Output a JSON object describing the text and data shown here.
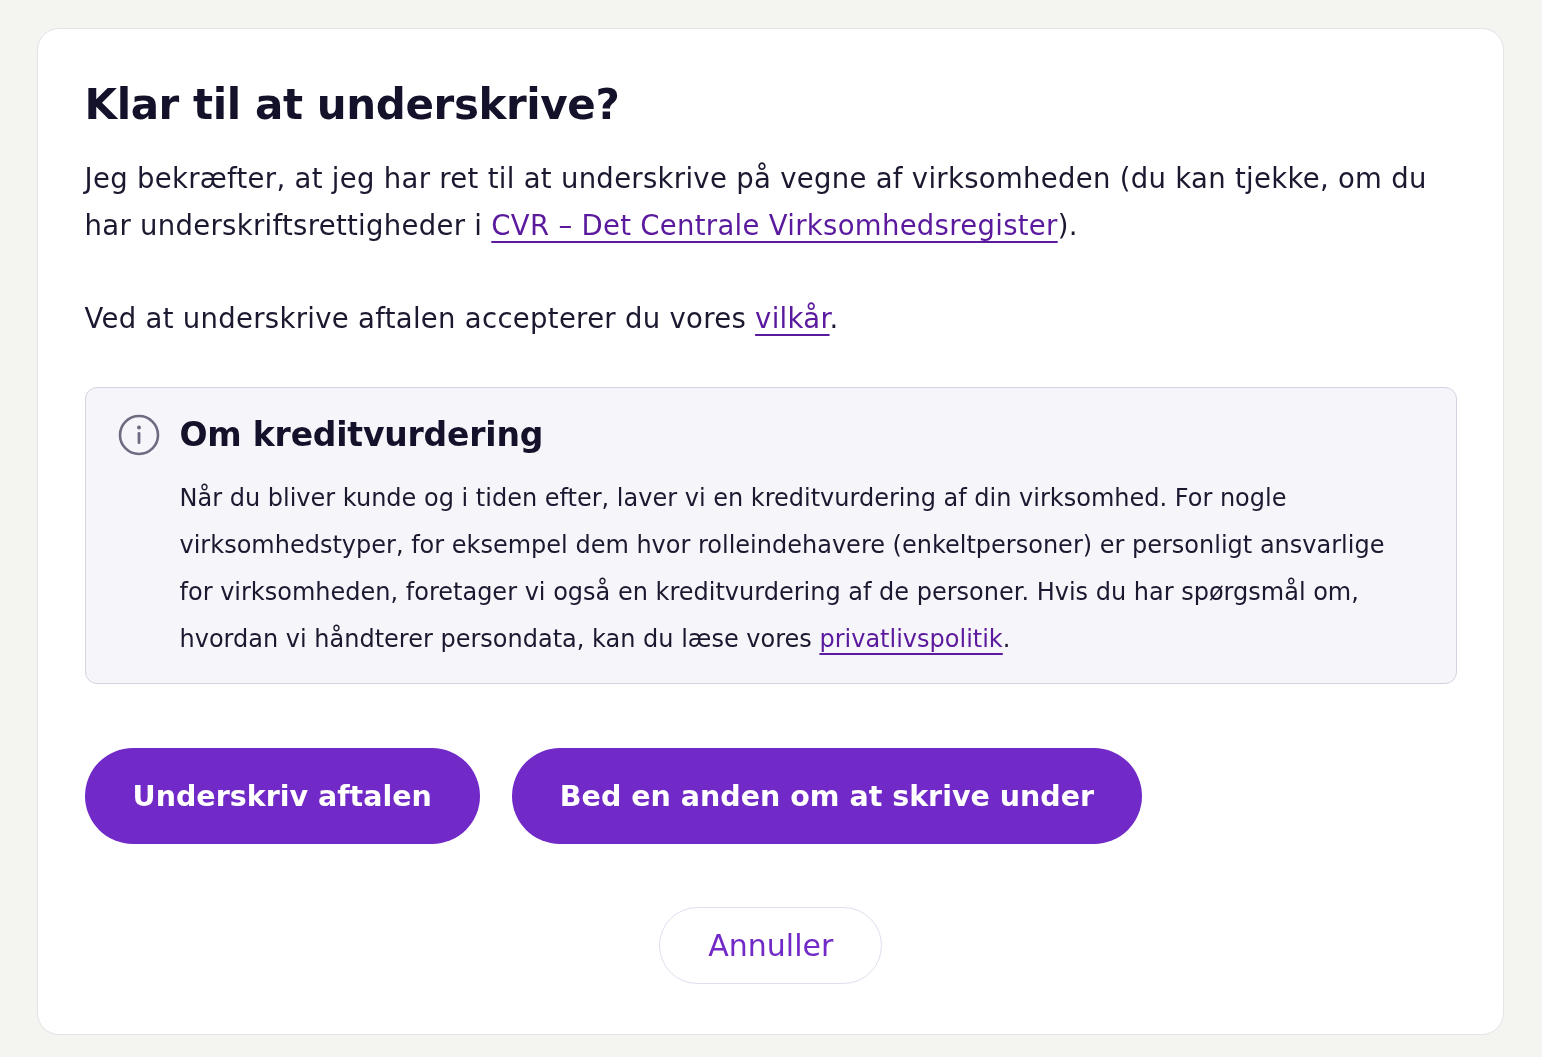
{
  "dialog": {
    "title": "Klar til at underskrive?",
    "paragraphs": [
      {
        "text_before": "Jeg bekræfter, at jeg har ret til at underskrive på vegne af virksomheden (du kan tjekke, om du har underskriftsrettigheder i ",
        "link": "CVR – Det Centrale Virksomhedsregister",
        "text_after": ")."
      },
      {
        "text_before": "Ved at underskrive aftalen accepterer du vores ",
        "link": "vilkår",
        "text_after": "."
      }
    ],
    "info_box": {
      "title": "Om kreditvurdering",
      "text_before": "Når du bliver kunde og i tiden efter, laver vi en kreditvurdering af din virksomhed. For nogle virksomhedstyper, for eksempel dem hvor rolleindehavere (enkeltpersoner) er personligt ansvarlige for virksomheden, foretager vi også en kreditvurdering af de personer. Hvis du har spørgsmål om, hvordan vi håndterer persondata, kan du læse vores ",
      "link": "privatlivspolitik",
      "text_after": "."
    },
    "buttons": [
      {
        "label": "Underskriv aftalen",
        "kind": "primary"
      },
      {
        "label": "Bed en anden om at skrive under",
        "kind": "primary"
      },
      {
        "label": "Annuller",
        "kind": "secondary"
      }
    ]
  }
}
